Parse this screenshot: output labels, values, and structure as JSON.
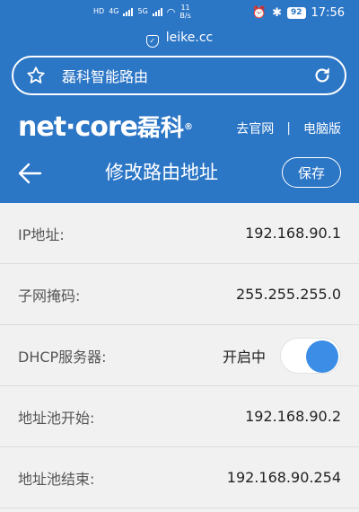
{
  "status_bar": {
    "net_left": "4G",
    "net_right": "5G",
    "speed_value": "11",
    "speed_unit": "B/s",
    "battery": "92",
    "time": "17:56"
  },
  "browser": {
    "url": "leike.cc",
    "page_title": "磊科智能路由"
  },
  "site": {
    "logo_text": "net·core",
    "logo_cn": "磊科",
    "link_official": "去官网",
    "separator": "|",
    "link_desktop": "电脑版"
  },
  "header": {
    "title": "修改路由地址",
    "save_label": "保存"
  },
  "fields": {
    "ip": {
      "label": "IP地址:",
      "value": "192.168.90.1"
    },
    "mask": {
      "label": "子网掩码:",
      "value": "255.255.255.0"
    },
    "dhcp": {
      "label": "DHCP服务器:",
      "status": "开启中"
    },
    "pool_start": {
      "label": "地址池开始:",
      "value": "192.168.90.2"
    },
    "pool_end": {
      "label": "地址池结束:",
      "value": "192.168.90.254"
    }
  },
  "colors": {
    "primary": "#2c76c6",
    "toggle_on": "#3b8de6"
  }
}
